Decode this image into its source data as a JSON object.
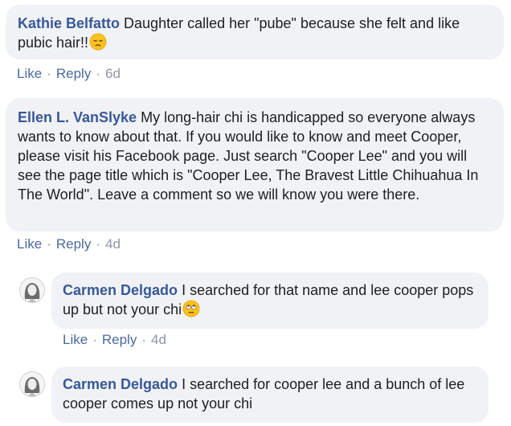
{
  "comments": [
    {
      "author": "Kathie Belfatto",
      "text": "Daughter called her \"pube\" because she felt and like pubic hair!!",
      "emoji": "pensive-face-emoji",
      "like": "Like",
      "reply": "Reply",
      "time": "6d"
    },
    {
      "author": "Ellen L. VanSlyke",
      "text": "My long-hair chi is handicapped so everyone always wants to know about that. If you would like to know and meet Cooper, please visit his Facebook page. Just search \"Cooper Lee\" and you will see the page title which is \"Cooper Lee, The Bravest Little Chihuahua In The World\". Leave a comment so we will know you were there.",
      "like": "Like",
      "reply": "Reply",
      "time": "4d"
    },
    {
      "author": "Carmen Delgado",
      "text": "I searched for that name and lee cooper pops up but not your chi",
      "emoji": "rolling-eyes-emoji",
      "like": "Like",
      "reply": "Reply",
      "time": "4d",
      "avatar": "avatar-photo"
    },
    {
      "author": "Carmen Delgado",
      "text": "I searched for cooper lee and a bunch of lee cooper comes up not your chi",
      "avatar": "avatar-photo"
    }
  ],
  "colors": {
    "author": "#385898",
    "bubble": "#f0f2f5",
    "action_link": "#4b6a9b",
    "meta": "#90949c"
  }
}
